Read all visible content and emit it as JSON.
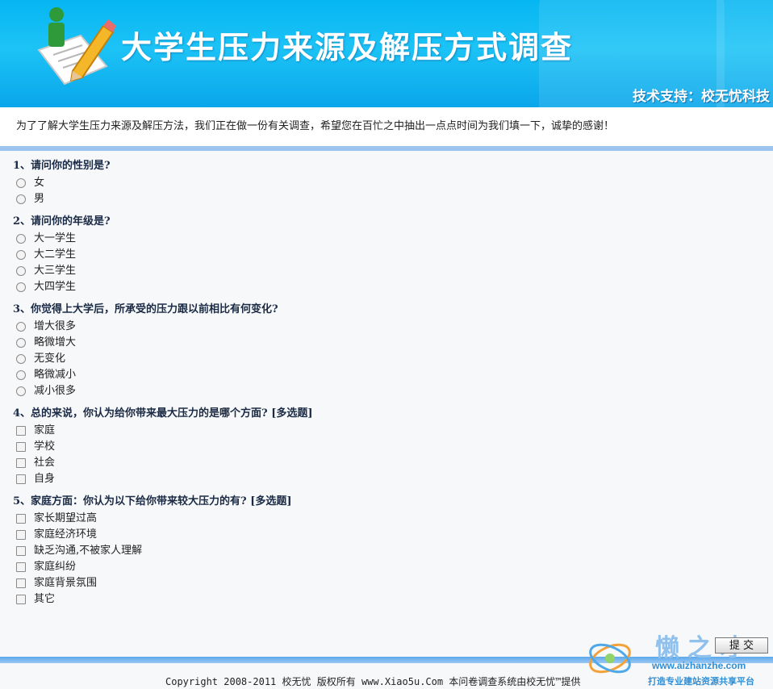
{
  "header": {
    "title": "大学生压力来源及解压方式调查",
    "support": "技术支持：校无忧科技"
  },
  "intro": "为了了解大学生压力来源及解压方法，我们正在做一份有关调查，希望您在百忙之中抽出一点点时间为我们填一下，诚挚的感谢！",
  "questions": [
    {
      "title": "1、请问你的性别是?",
      "type": "radio",
      "options": [
        "女",
        "男"
      ]
    },
    {
      "title": "2、请问你的年级是?",
      "type": "radio",
      "options": [
        "大一学生",
        "大二学生",
        "大三学生",
        "大四学生"
      ]
    },
    {
      "title": "3、你觉得上大学后，所承受的压力跟以前相比有何变化?",
      "type": "radio",
      "options": [
        "增大很多",
        "略微增大",
        "无变化",
        "略微减小",
        "减小很多"
      ]
    },
    {
      "title": "4、总的来说，你认为给你带来最大压力的是哪个方面? [多选题]",
      "type": "checkbox",
      "options": [
        "家庭",
        "学校",
        "社会",
        "自身"
      ]
    },
    {
      "title": "5、家庭方面：你认为以下给你带来较大压力的有? [多选题]",
      "type": "checkbox",
      "options": [
        "家长期望过高",
        "家庭经济环境",
        "缺乏沟通,不被家人理解",
        "家庭纠纷",
        "家庭背景氛围",
        "其它"
      ]
    }
  ],
  "submit_label": "提 交",
  "footer": {
    "copyright": "Copyright 2008-2011 校无忧 版权所有 www.Xiao5u.Com 本问卷调查系统由校无忧™提供"
  },
  "watermark": {
    "big": "懒之才",
    "url": "www.aizhanzhe.com",
    "slogan": "打造专业建站资源共享平台"
  },
  "colors": {
    "banner": "#0aa6ea",
    "accent_bar": "#9cc4ef",
    "question_title": "#1a2a44"
  }
}
